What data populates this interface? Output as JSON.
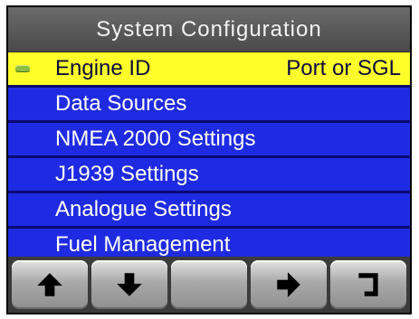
{
  "title": "System Configuration",
  "menu": {
    "items": [
      {
        "label": "Engine ID",
        "value": "Port or SGL",
        "selected": true
      },
      {
        "label": "Data Sources",
        "value": ""
      },
      {
        "label": "NMEA 2000 Settings",
        "value": ""
      },
      {
        "label": "J1939 Settings",
        "value": ""
      },
      {
        "label": "Analogue Settings",
        "value": ""
      },
      {
        "label": "Fuel Management",
        "value": ""
      }
    ]
  },
  "softkeys": [
    {
      "icon": "arrow-up-icon"
    },
    {
      "icon": "arrow-down-icon"
    },
    {
      "icon": ""
    },
    {
      "icon": "arrow-right-icon"
    },
    {
      "icon": "back-icon"
    }
  ],
  "colors": {
    "title_bg": "#5b5b5b",
    "item_bg": "#1f2be3",
    "selected_bg": "#fffe2a",
    "selected_marker": "#8fbf3f"
  }
}
